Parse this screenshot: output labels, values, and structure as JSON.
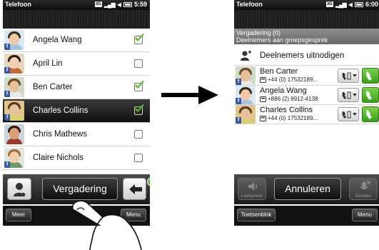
{
  "left_screen": {
    "status": {
      "title": "Telefoon",
      "network": "3G",
      "signal_label": "3G",
      "time": "5:59"
    },
    "contacts": [
      {
        "name": "Angela Wang",
        "checked": true,
        "selected": false,
        "facebook": "f",
        "skin": "#f0c8a8",
        "hair": "#3a2a1a",
        "shirt": "#9bc4e6",
        "bg": "#d8e8f4"
      },
      {
        "name": "April Lin",
        "checked": false,
        "selected": false,
        "facebook": "f",
        "skin": "#f2d0b4",
        "hair": "#2a1d14",
        "shirt": "#c26a3a",
        "bg": "#e9d6c0"
      },
      {
        "name": "Ben Carter",
        "checked": true,
        "selected": false,
        "facebook": "f",
        "skin": "#e7bf98",
        "hair": "#6b4a2a",
        "shirt": "#e9e9e9",
        "bg": "#cfdcc8"
      },
      {
        "name": "Charles Collins",
        "checked": true,
        "selected": true,
        "facebook": "f",
        "skin": "#e9c09c",
        "hair": "#5a3a1e",
        "shirt": "#d8d26a",
        "bg": "#e2c48a"
      },
      {
        "name": "Chris Mathews",
        "checked": false,
        "selected": false,
        "facebook": "",
        "skin": "#d8a078",
        "hair": "#2e1a10",
        "shirt": "#9c3a2a",
        "bg": "#c9d4dc"
      },
      {
        "name": "Claire Nichols",
        "checked": false,
        "selected": false,
        "facebook": "f",
        "skin": "#f0ccb0",
        "hair": "#a06a38",
        "shirt": "#6a9a6a",
        "bg": "#dfe7d6"
      }
    ],
    "conference_button": {
      "label": "Vergadering",
      "count": "3"
    },
    "softkeys": {
      "left": "Meer",
      "right": "Menu"
    }
  },
  "right_screen": {
    "status": {
      "title": "Telefoon",
      "network": "3G",
      "signal_label": "3G",
      "time": "6:00"
    },
    "group_header": {
      "title": "Vergadering (0)",
      "subtitle": "Deelnemers aan groepsgesprek"
    },
    "invite_label": "Deelnemers uitnodigen",
    "participants": [
      {
        "name": "Ben Carter",
        "number": "+44 (0) 17532189...",
        "facebook": "f",
        "skin": "#e7bf98",
        "hair": "#6b4a2a",
        "shirt": "#e9e9e9",
        "bg": "#cfdcc8"
      },
      {
        "name": "Angela Wang",
        "number": "+886 (2) 8912-4138",
        "facebook": "f",
        "skin": "#f0c8a8",
        "hair": "#3a2a1a",
        "shirt": "#9bc4e6",
        "bg": "#d8e8f4"
      },
      {
        "name": "Charles Collins",
        "number": "+44 (0) 17532189...",
        "facebook": "f",
        "skin": "#e9c09c",
        "hair": "#5a3a1e",
        "shirt": "#d8d26a",
        "bg": "#e2c48a"
      }
    ],
    "action_bar": {
      "left_label": "Luidspreker",
      "cancel_label": "Annuleren",
      "right_label": "Dempen"
    },
    "softkeys": {
      "left": "Toetsenblok",
      "right": "Menu"
    }
  },
  "colors": {
    "check_green": "#5cb82a",
    "call_green": "#4caf24",
    "badge_green": "#5cbf2a",
    "facebook_blue": "#3b5998"
  }
}
